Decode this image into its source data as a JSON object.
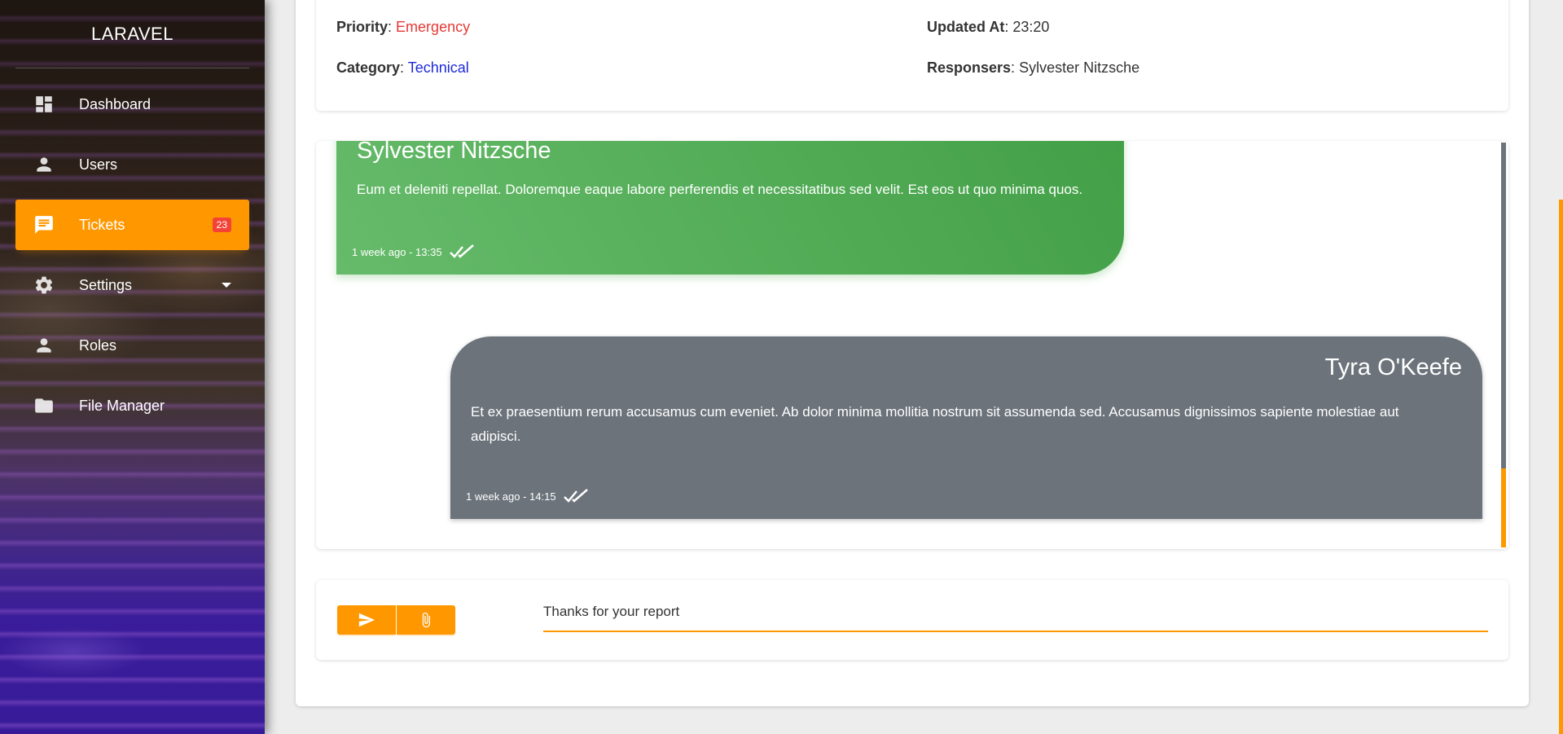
{
  "sidebar": {
    "brand": "LARAVEL",
    "items": [
      {
        "label": "Dashboard",
        "icon": "dashboard-icon"
      },
      {
        "label": "Users",
        "icon": "person-icon"
      },
      {
        "label": "Tickets",
        "icon": "chat-icon",
        "badge": "23",
        "active": true
      },
      {
        "label": "Settings",
        "icon": "gear-icon"
      },
      {
        "label": "Roles",
        "icon": "person-icon"
      },
      {
        "label": "File Manager",
        "icon": "folder-icon"
      }
    ]
  },
  "ticket": {
    "priority_label": "Priority",
    "priority_value": "Emergency",
    "category_label": "Category",
    "category_value": "Technical",
    "updated_label": "Updated At",
    "updated_value": "23:20",
    "responsers_label": "Responsers",
    "responsers_value": "Sylvester Nitzsche"
  },
  "messages": [
    {
      "author": "Sylvester Nitzsche",
      "body": "Eum et deleniti repellat. Doloremque eaque labore perferendis et necessitatibus sed velit. Est eos ut quo minima quos.",
      "time": "1 week ago - 13:35"
    },
    {
      "author": "Tyra O'Keefe",
      "body": "Et ex praesentium rerum accusamus cum eveniet. Ab dolor minima mollitia nostrum sit assumenda sed. Accusamus dignissimos sapiente molestiae aut adipisci.",
      "time": "1 week ago - 14:15"
    }
  ],
  "composer": {
    "value": "Thanks for your report"
  },
  "colors": {
    "accent": "#ff9800",
    "priority": "#e53935",
    "category": "#1e2ad6",
    "message_left": "#4caf50",
    "message_right": "#6c737b",
    "badge": "#f44336"
  }
}
